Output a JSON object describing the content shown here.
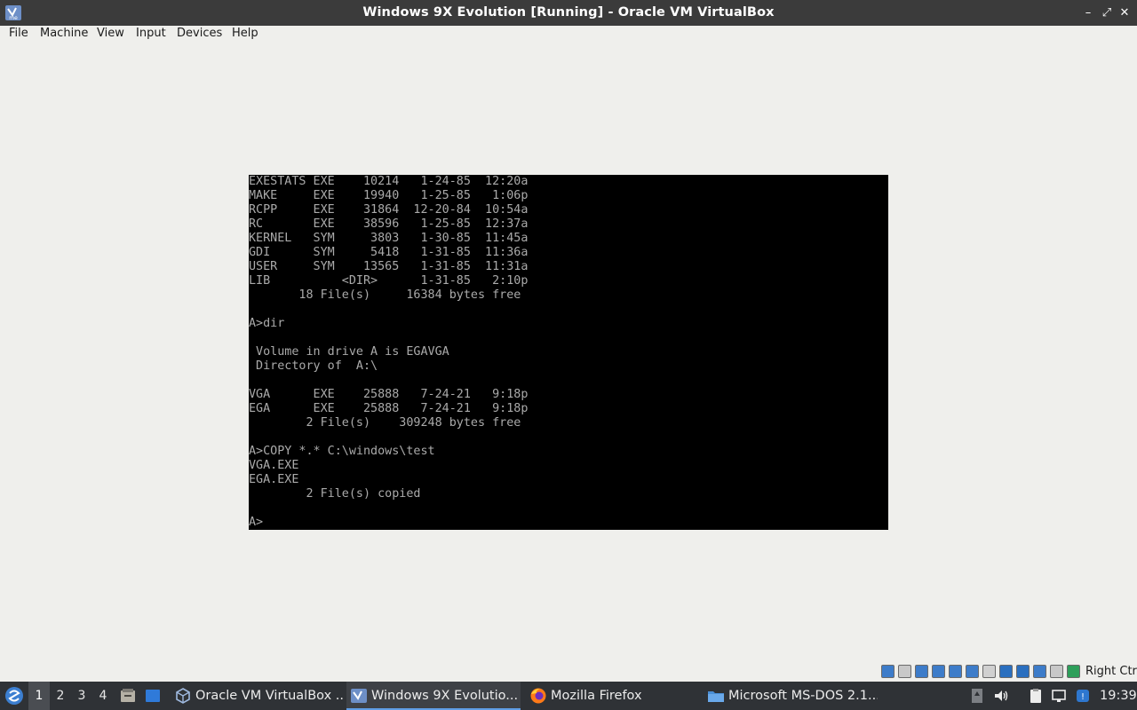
{
  "window": {
    "title": "Windows 9X Evolution [Running] - Oracle VM VirtualBox",
    "minimize_glyph": "–",
    "maximize_glyph": "⤢",
    "close_glyph": "✕"
  },
  "menu": {
    "items": [
      {
        "label": "File"
      },
      {
        "label": "Machine"
      },
      {
        "label": "View"
      },
      {
        "label": "Input"
      },
      {
        "label": "Devices"
      },
      {
        "label": "Help"
      }
    ]
  },
  "console": {
    "lines": [
      "EXESTATS EXE    10214   1-24-85  12:20a",
      "MAKE     EXE    19940   1-25-85   1:06p",
      "RCPP     EXE    31864  12-20-84  10:54a",
      "RC       EXE    38596   1-25-85  12:37a",
      "KERNEL   SYM     3803   1-30-85  11:45a",
      "GDI      SYM     5418   1-31-85  11:36a",
      "USER     SYM    13565   1-31-85  11:31a",
      "LIB          <DIR>      1-31-85   2:10p",
      "       18 File(s)     16384 bytes free",
      "",
      "A>dir",
      "",
      " Volume in drive A is EGAVGA",
      " Directory of  A:\\",
      "",
      "VGA      EXE    25888   7-24-21   9:18p",
      "EGA      EXE    25888   7-24-21   9:18p",
      "        2 File(s)    309248 bytes free",
      "",
      "A>COPY *.* C:\\windows\\test",
      "VGA.EXE",
      "EGA.EXE",
      "        2 File(s) copied",
      "",
      "A>"
    ]
  },
  "status_bar": {
    "host_key_label": "Right Ctrl",
    "icons": [
      {
        "name": "optical-drive-icon",
        "color": "#3d7cc9"
      },
      {
        "name": "audio-icon",
        "color": "#c8c8c8"
      },
      {
        "name": "hard-disk-icon",
        "color": "#3d7cc9"
      },
      {
        "name": "network-icon",
        "color": "#3d7cc9"
      },
      {
        "name": "usb-icon",
        "color": "#3d7cc9"
      },
      {
        "name": "shared-folder-icon",
        "color": "#3d7cc9"
      },
      {
        "name": "display-icon",
        "color": "#d0d0d0"
      },
      {
        "name": "video-capture-icon",
        "color": "#2a6fbf"
      },
      {
        "name": "recording-icon",
        "color": "#2a6fbf"
      },
      {
        "name": "cpu-icon",
        "color": "#3d7cc9"
      },
      {
        "name": "mouse-integration-icon",
        "color": "#c8c8c8"
      },
      {
        "name": "keyboard-capture-icon",
        "color": "#2e9f5a"
      }
    ]
  },
  "taskbar": {
    "workspaces": [
      {
        "label": "1",
        "active": true
      },
      {
        "label": "2",
        "active": false
      },
      {
        "label": "3",
        "active": false
      },
      {
        "label": "4",
        "active": false
      }
    ],
    "tasks": [
      {
        "label": "Oracle VM VirtualBox ...",
        "icon": "virtualbox-icon",
        "active": false
      },
      {
        "label": "Windows 9X Evolutio...",
        "icon": "vm-window-icon",
        "active": true
      },
      {
        "label": "Mozilla Firefox",
        "icon": "firefox-icon",
        "active": false
      },
      {
        "label": "Microsoft MS-DOS 2.1...",
        "icon": "folder-icon",
        "active": false
      }
    ],
    "clock": "19:39",
    "accent_color": "#5f9ee6"
  }
}
